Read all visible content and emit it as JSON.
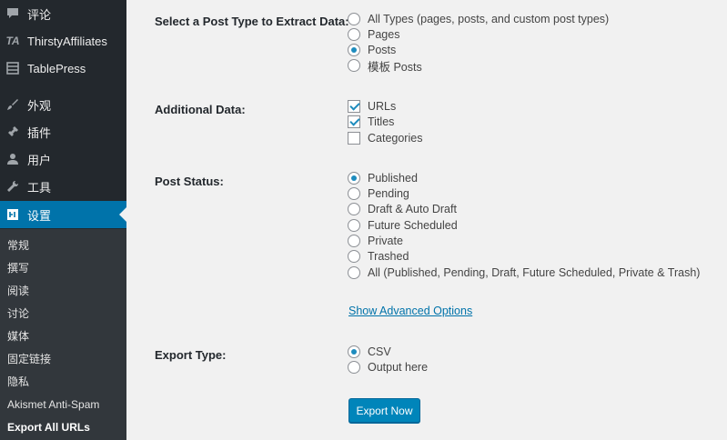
{
  "sidebar": {
    "items": [
      {
        "label": "评论",
        "icon": "comment-icon"
      },
      {
        "label": "ThirstyAffiliates",
        "icon": "thirstyaffiliates-icon"
      },
      {
        "label": "TablePress",
        "icon": "table-icon"
      },
      {
        "label": "外观",
        "icon": "paintbrush-icon"
      },
      {
        "label": "插件",
        "icon": "plugin-icon"
      },
      {
        "label": "用户",
        "icon": "user-icon"
      },
      {
        "label": "工具",
        "icon": "wrench-icon"
      },
      {
        "label": "设置",
        "icon": "settings-icon"
      }
    ],
    "submenu": [
      "常规",
      "撰写",
      "阅读",
      "讨论",
      "媒体",
      "固定链接",
      "隐私",
      "Akismet Anti-Spam",
      "Export All URLs"
    ]
  },
  "form": {
    "post_type_label": "Select a Post Type to Extract Data:",
    "post_types": [
      "All Types (pages, posts, and custom post types)",
      "Pages",
      "Posts",
      "模板 Posts"
    ],
    "post_type_selected": 2,
    "additional_label": "Additional Data:",
    "additional": [
      {
        "label": "URLs",
        "checked": true
      },
      {
        "label": "Titles",
        "checked": true
      },
      {
        "label": "Categories",
        "checked": false
      }
    ],
    "status_label": "Post Status:",
    "statuses": [
      "Published",
      "Pending",
      "Draft & Auto Draft",
      "Future Scheduled",
      "Private",
      "Trashed",
      "All (Published, Pending, Draft, Future Scheduled, Private & Trash)"
    ],
    "status_selected": 0,
    "advanced_link": "Show Advanced Options",
    "export_type_label": "Export Type:",
    "export_types": [
      "CSV",
      "Output here"
    ],
    "export_type_selected": 0,
    "export_button": "Export Now"
  }
}
